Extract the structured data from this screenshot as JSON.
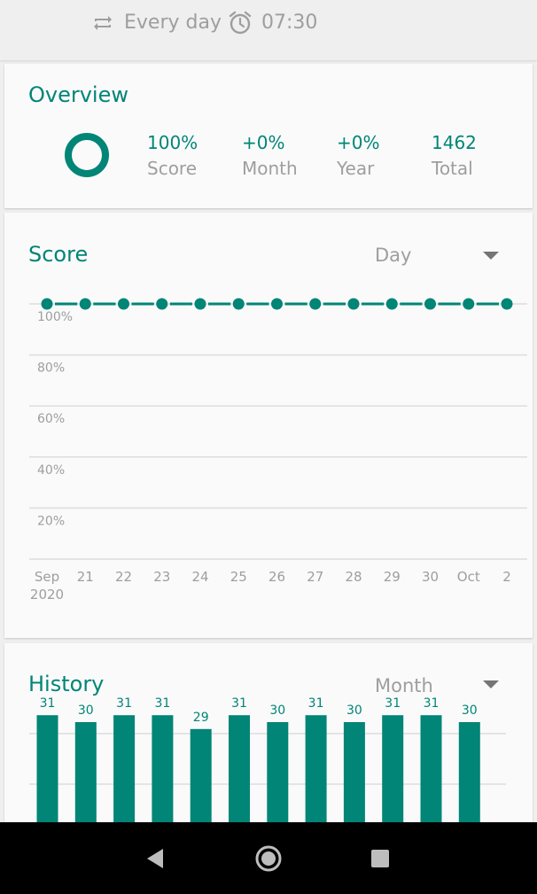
{
  "header": {
    "frequency": "Every day",
    "reminder_time": "07:30",
    "icons": [
      "repeat-icon",
      "alarm-clock-icon"
    ]
  },
  "overview": {
    "title": "Overview",
    "score_value": "100%",
    "score_label": "Score",
    "month_value": "+0%",
    "month_label": "Month",
    "year_value": "+0%",
    "year_label": "Year",
    "total_value": "1462",
    "total_label": "Total",
    "ring_fraction": 1.0
  },
  "score": {
    "title": "Score",
    "period": "Day"
  },
  "history": {
    "title": "History",
    "period": "Month"
  },
  "colors": {
    "accent": "#008577",
    "muted_text": "#9e9e9e",
    "grid": "#dddddd"
  },
  "navigation": {
    "icons": [
      "back-icon",
      "home-icon",
      "recents-icon"
    ]
  },
  "chart_data": [
    {
      "type": "line",
      "title": "Score",
      "x": [
        "Sep\n2020",
        "21",
        "22",
        "23",
        "24",
        "25",
        "26",
        "27",
        "28",
        "29",
        "30",
        "Oct",
        "2"
      ],
      "x_points_count": 13,
      "values": [
        100,
        100,
        100,
        100,
        100,
        100,
        100,
        100,
        100,
        100,
        100,
        100,
        100
      ],
      "y_ticks": [
        "100%",
        "80%",
        "60%",
        "40%",
        "20%"
      ],
      "ylim": [
        0,
        100
      ],
      "grid": true,
      "color": "#008577"
    },
    {
      "type": "bar",
      "title": "History",
      "values": [
        31,
        30,
        31,
        31,
        29,
        31,
        30,
        31,
        30,
        31,
        31,
        30
      ],
      "data_labels": true,
      "grid": true,
      "color": "#008577"
    }
  ]
}
